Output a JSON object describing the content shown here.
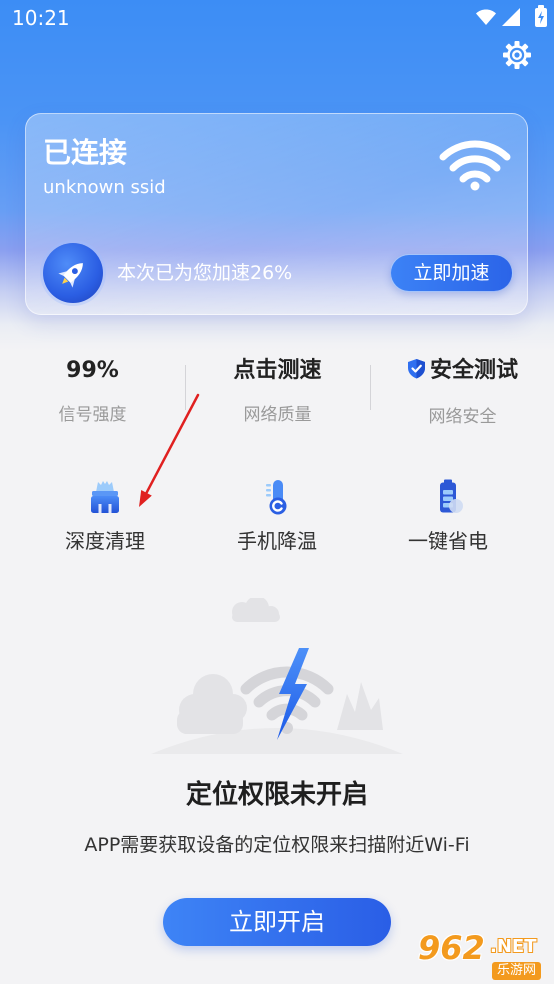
{
  "status_bar": {
    "time": "10:21",
    "icons": [
      "wifi-status-icon",
      "signal-icon",
      "battery-status-icon"
    ]
  },
  "header": {
    "settings_icon": "gear-icon"
  },
  "connection_card": {
    "status": "已连接",
    "ssid": "unknown ssid",
    "wifi_icon": "wifi-icon",
    "rocket_icon": "rocket-icon",
    "boost_text": "本次已为您加速26%",
    "boost_button": "立即加速"
  },
  "stats": [
    {
      "value": "99%",
      "label": "信号强度"
    },
    {
      "value": "点击测速",
      "label": "网络质量"
    },
    {
      "value": "安全测试",
      "label": "网络安全",
      "icon": "shield-icon"
    }
  ],
  "tools": [
    {
      "label": "深度清理",
      "icon": "broom-icon"
    },
    {
      "label": "手机降温",
      "icon": "thermometer-icon"
    },
    {
      "label": "一键省电",
      "icon": "battery-icon"
    }
  ],
  "location_prompt": {
    "illustration": "wifi-lightning-illustration",
    "title": "定位权限未开启",
    "description": "APP需要获取设备的定位权限来扫描附近Wi-Fi",
    "button": "立即开启"
  },
  "annotation": {
    "type": "arrow",
    "color": "#e02020"
  },
  "watermark": {
    "number": "962",
    "domain": ".NET",
    "name": "乐游网"
  },
  "colors": {
    "header_blue": "#3c8df5",
    "accent_blue": "#2f6ff0",
    "background": "#f3f3f5",
    "watermark_orange": "#f39a1e"
  }
}
